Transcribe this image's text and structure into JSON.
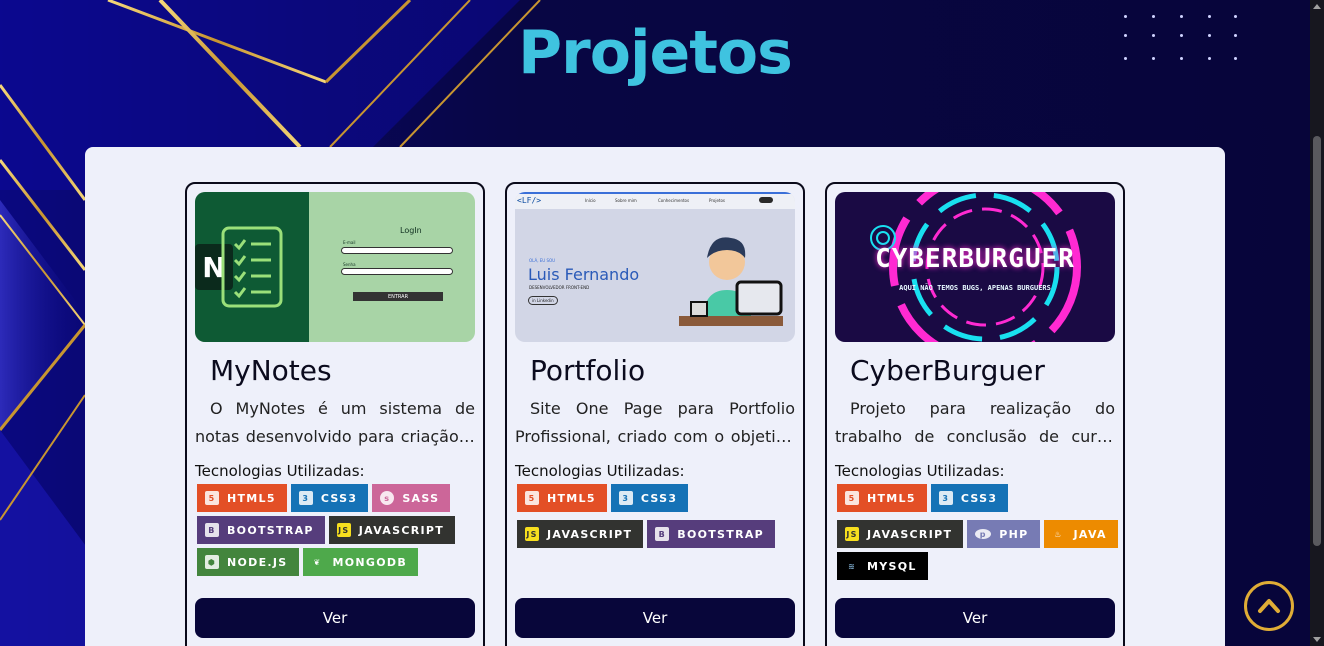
{
  "section": {
    "title": "Projetos"
  },
  "projects": [
    {
      "name": "MyNotes",
      "description": "O MyNotes é um sistema de notas desenvolvido para criação e organização de anotações pessoais.",
      "tech_label": "Tecnologias Utilizadas:",
      "badges": [
        {
          "label": "HTML5",
          "color": "#e34f26",
          "icon": "html5-icon"
        },
        {
          "label": "CSS3",
          "color": "#1572b6",
          "icon": "css3-icon"
        },
        {
          "label": "SASS",
          "color": "#cc6699",
          "icon": "sass-icon"
        },
        {
          "label": "BOOTSTRAP",
          "color": "#563d7c",
          "icon": "bootstrap-icon"
        },
        {
          "label": "JAVASCRIPT",
          "color": "#323330",
          "icon": "javascript-icon"
        },
        {
          "label": "NODE.JS",
          "color": "#43853d",
          "icon": "nodejs-icon"
        },
        {
          "label": "MONGODB",
          "color": "#4ea94b",
          "icon": "mongodb-icon"
        }
      ],
      "button": "Ver",
      "thumb": {
        "title": "LogIn",
        "field1": "E-mail",
        "field2": "Senha",
        "button": "ENTRAR",
        "logo": "N"
      }
    },
    {
      "name": "Portfolio",
      "description": "Site One Page para Portfolio Profissional, criado com o objetivo de apresentar meus projetos.",
      "tech_label": "Tecnologias Utilizadas:",
      "badges": [
        {
          "label": "HTML5",
          "color": "#e34f26",
          "icon": "html5-icon"
        },
        {
          "label": "CSS3",
          "color": "#1572b6",
          "icon": "css3-icon"
        },
        {
          "label": "JAVASCRIPT",
          "color": "#323330",
          "icon": "javascript-icon"
        },
        {
          "label": "BOOTSTRAP",
          "color": "#563d7c",
          "icon": "bootstrap-icon"
        }
      ],
      "button": "Ver",
      "thumb": {
        "logo": "<LF/>",
        "nav": [
          "Início",
          "Sobre mim",
          "Conhecimentos",
          "Projetos"
        ],
        "greeting": "OLÁ, EU SOU",
        "name": "Luis Fernando",
        "role": "DESENVOLVEDOR FRONT-END",
        "linkedin": "in Linkedin"
      }
    },
    {
      "name": "CyberBurguer",
      "description": "Projeto para realização do trabalho de conclusão de curso técnico em informática.",
      "tech_label": "Tecnologias Utilizadas:",
      "badges": [
        {
          "label": "HTML5",
          "color": "#e34f26",
          "icon": "html5-icon"
        },
        {
          "label": "CSS3",
          "color": "#1572b6",
          "icon": "css3-icon"
        },
        {
          "label": "JAVASCRIPT",
          "color": "#323330",
          "icon": "javascript-icon"
        },
        {
          "label": "PHP",
          "color": "#777bb4",
          "icon": "php-icon"
        },
        {
          "label": "JAVA",
          "color": "#ed8b00",
          "icon": "java-icon"
        },
        {
          "label": "MYSQL",
          "color": "#000000",
          "icon": "mysql-icon"
        }
      ],
      "button": "Ver",
      "thumb": {
        "title": "CYBERBURGUER",
        "subtitle": "AQUI NÃO TEMOS BUGS, APENAS BURGUERS"
      }
    }
  ],
  "colors": {
    "title": "#3fc3e0",
    "panel": "#eef0fa",
    "button": "#08063a",
    "to_top_ring": "#e0ad36"
  },
  "icons": {
    "back_to_top": "chevron-up-icon"
  }
}
